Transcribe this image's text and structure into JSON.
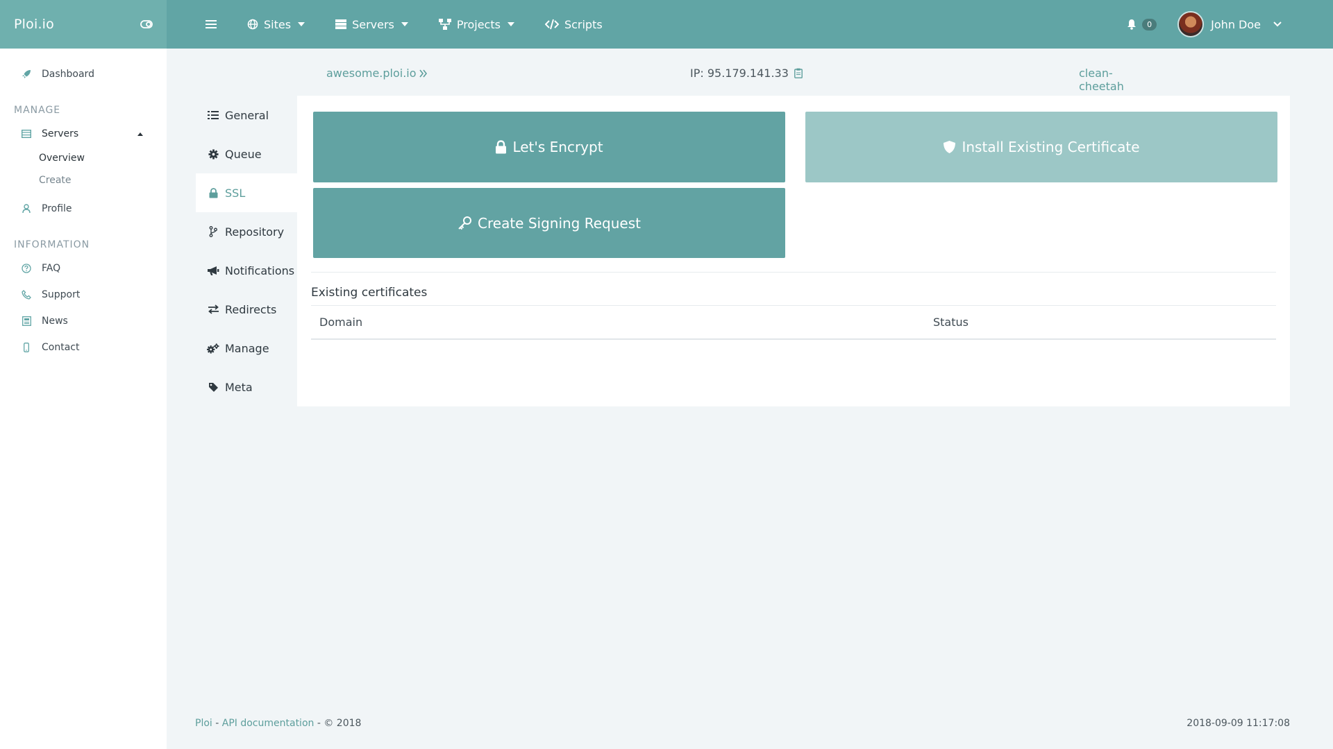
{
  "topbar": {
    "brand": "Ploi.io",
    "nav": [
      {
        "label": "Sites",
        "icon": "globe-icon"
      },
      {
        "label": "Servers",
        "icon": "server-icon"
      },
      {
        "label": "Projects",
        "icon": "sitemap-icon"
      },
      {
        "label": "Scripts",
        "icon": "code-icon"
      }
    ],
    "notifications_count": "0",
    "user_name": "John Doe"
  },
  "sidebar": {
    "dashboard": "Dashboard",
    "manage_heading": "MANAGE",
    "servers": "Servers",
    "servers_sub": [
      "Overview",
      "Create"
    ],
    "profile": "Profile",
    "information_heading": "INFORMATION",
    "info_links": [
      "FAQ",
      "Support",
      "News",
      "Contact"
    ]
  },
  "server_header": {
    "site": "awesome.ploi.io",
    "ip": "IP: 95.179.141.33",
    "name": "clean-cheetah"
  },
  "tabs": [
    "General",
    "Queue",
    "SSL",
    "Repository",
    "Notifications",
    "Redirects",
    "Manage",
    "Meta"
  ],
  "active_tab": "SSL",
  "ssl": {
    "lets_encrypt": "Let's Encrypt",
    "install_existing": "Install Existing Certificate",
    "create_signing": "Create Signing Request",
    "existing_title": "Existing certificates",
    "columns": [
      "Domain",
      "Status"
    ]
  },
  "footer": {
    "ploi": "Ploi",
    "sep1": " - ",
    "api_docs": "API documentation",
    "copyright": " - © 2018",
    "timestamp": "2018-09-09 11:17:08"
  },
  "colors": {
    "accent": "#61a5a5",
    "accent_light": "#9cc7c6",
    "background": "#f1f5f7"
  }
}
